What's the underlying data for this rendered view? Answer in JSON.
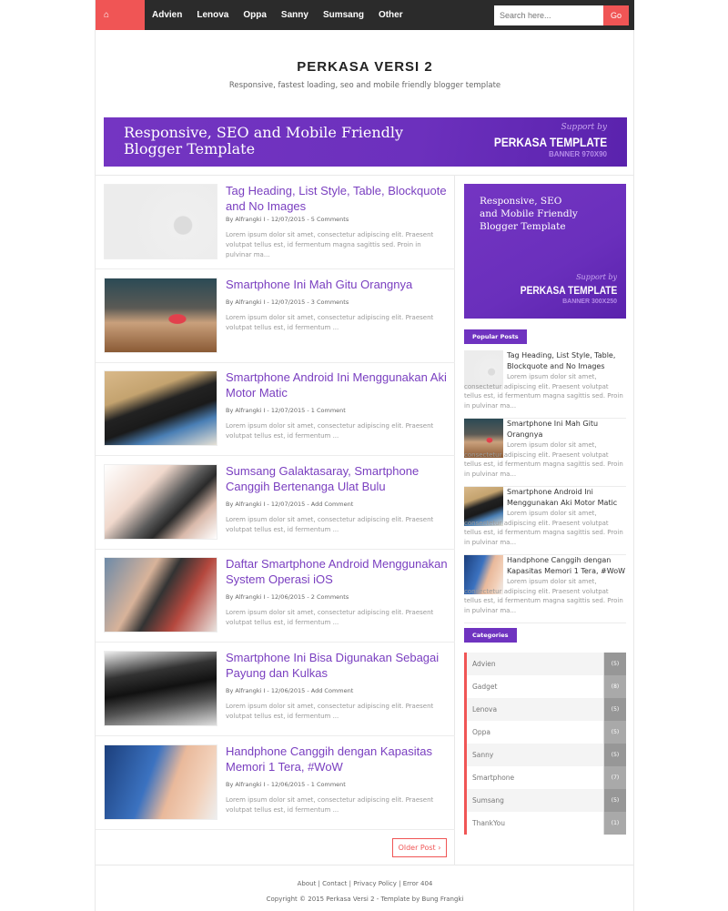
{
  "nav": {
    "items": [
      "Home",
      "Advien",
      "Lenova",
      "Oppa",
      "Sanny",
      "Sumsang",
      "Other"
    ],
    "search_placeholder": "Search here...",
    "search_button": "Go"
  },
  "header": {
    "title": "PERKASA VERSI 2",
    "tagline": "Responsive, fastest loading, seo and mobile friendly blogger template"
  },
  "banner": {
    "line1": "Responsive, SEO and Mobile Friendly",
    "line2": "Blogger Template",
    "support": "Support by",
    "brand": "PERKASA TEMPLATE",
    "size": "BANNER 970X90"
  },
  "posts": [
    {
      "title": "Tag Heading, List Style, Table, Blockquote and No Images",
      "meta": "By Alfrangki I - 12/07/2015 - 5 Comments",
      "excerpt": "Lorem ipsum dolor sit amet, consectetur adipiscing elit. Praesent volutpat tellus est, id fermentum magna sagittis sed. Proin in pulvinar ma..."
    },
    {
      "title": "Smartphone Ini Mah Gitu Orangnya",
      "meta": "By Alfrangki I - 12/07/2015 - 3 Comments",
      "excerpt": "Lorem ipsum dolor sit amet, consectetur adipiscing elit. Praesent volutpat tellus est, id fermentum ..."
    },
    {
      "title": "Smartphone Android Ini Menggunakan Aki Motor Matic",
      "meta": "By Alfrangki I - 12/07/2015 - 1 Comment",
      "excerpt": "Lorem ipsum dolor sit amet, consectetur adipiscing elit. Praesent volutpat tellus est, id fermentum ..."
    },
    {
      "title": "Sumsang Galaktasaray, Smartphone Canggih Bertenanga Ulat Bulu",
      "meta": "By Alfrangki I - 12/07/2015 - Add Comment",
      "excerpt": "Lorem ipsum dolor sit amet, consectetur adipiscing elit. Praesent volutpat tellus est, id fermentum ..."
    },
    {
      "title": "Daftar Smartphone Android Menggunakan System Operasi iOS",
      "meta": "By Alfrangki I - 12/06/2015 - 2 Comments",
      "excerpt": "Lorem ipsum dolor sit amet, consectetur adipiscing elit. Praesent volutpat tellus est, id fermentum ..."
    },
    {
      "title": "Smartphone Ini Bisa Digunakan Sebagai Payung dan Kulkas",
      "meta": "By Alfrangki I - 12/06/2015 - Add Comment",
      "excerpt": "Lorem ipsum dolor sit amet, consectetur adipiscing elit. Praesent volutpat tellus est, id fermentum ..."
    },
    {
      "title": "Handphone Canggih dengan Kapasitas Memori 1 Tera, #WoW",
      "meta": "By Alfrangki I - 12/06/2015 - 1 Comment",
      "excerpt": "Lorem ipsum dolor sit amet, consectetur adipiscing elit. Praesent volutpat tellus est, id fermentum ..."
    }
  ],
  "older_post": "Older Post ›",
  "sidebar": {
    "banner": {
      "line1": "Responsive, SEO",
      "line2": "and Mobile Friendly",
      "line3": "Blogger Template",
      "support": "Support by",
      "brand": "PERKASA TEMPLATE",
      "size": "BANNER 300X250"
    },
    "popular_label": "Popular Posts",
    "popular": [
      {
        "title": "Tag Heading, List Style, Table, Blockquote and No Images",
        "excerpt": "Lorem ipsum dolor sit amet, consectetur adipiscing elit. Praesent volutpat tellus est, id fermentum magna sagittis sed. Proin in pulvinar ma..."
      },
      {
        "title": "Smartphone Ini Mah Gitu Orangnya",
        "excerpt": "Lorem ipsum dolor sit amet, consectetur adipiscing elit. Praesent volutpat tellus est, id fermentum magna sagittis sed. Proin in pulvinar ma..."
      },
      {
        "title": "Smartphone Android Ini Menggunakan Aki Motor Matic",
        "excerpt": "Lorem ipsum dolor sit amet, consectetur adipiscing elit. Praesent volutpat tellus est, id fermentum magna sagittis sed. Proin in pulvinar ma..."
      },
      {
        "title": "Handphone Canggih dengan Kapasitas Memori 1 Tera, #WoW",
        "excerpt": "Lorem ipsum dolor sit amet, consectetur adipiscing elit. Praesent volutpat tellus est, id fermentum magna sagittis sed. Proin in pulvinar ma..."
      }
    ],
    "categories_label": "Categories",
    "categories": [
      {
        "name": "Advien",
        "count": "(5)"
      },
      {
        "name": "Gadget",
        "count": "(8)"
      },
      {
        "name": "Lenova",
        "count": "(5)"
      },
      {
        "name": "Oppa",
        "count": "(5)"
      },
      {
        "name": "Sanny",
        "count": "(5)"
      },
      {
        "name": "Smartphone",
        "count": "(7)"
      },
      {
        "name": "Sumsang",
        "count": "(5)"
      },
      {
        "name": "ThankYou",
        "count": "(1)"
      }
    ]
  },
  "footer": {
    "links": [
      "About",
      "Contact",
      "Privacy Policy",
      "Error 404"
    ],
    "separator": " | ",
    "copyright": "Copyright © 2015 Perkasa Versi 2 - Template by Bung Frangki"
  },
  "colors": {
    "accent": "#f05555",
    "purple": "#7a3fc0",
    "nav_bg": "#2b2b2b"
  }
}
